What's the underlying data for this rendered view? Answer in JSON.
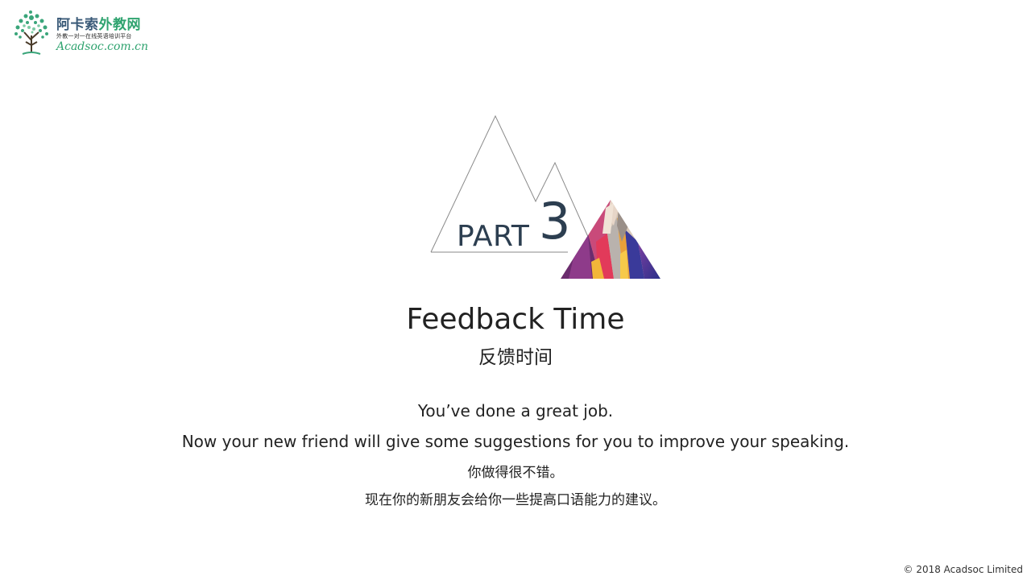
{
  "logo": {
    "name_part1": "阿卡索",
    "name_part2": "外教网",
    "tagline": "外教一对一在线英语培训平台",
    "url": "Acadsoc.com.cn",
    "brand_colors": {
      "dark": "#3a5a78",
      "green": "#2fa36f"
    }
  },
  "section": {
    "part_label": "PART",
    "part_number": "3"
  },
  "title": "Feedback Time",
  "subtitle": "反馈时间",
  "body": {
    "line1": "You’ve done a great job.",
    "line2": "Now your new friend will give some suggestions for you to improve your speaking.",
    "line3": "你做得很不错。",
    "line4": "现在你的新朋友会给你一些提高口语能力的建议。"
  },
  "footer": {
    "copyright": "© 2018 Acadsoc Limited"
  }
}
